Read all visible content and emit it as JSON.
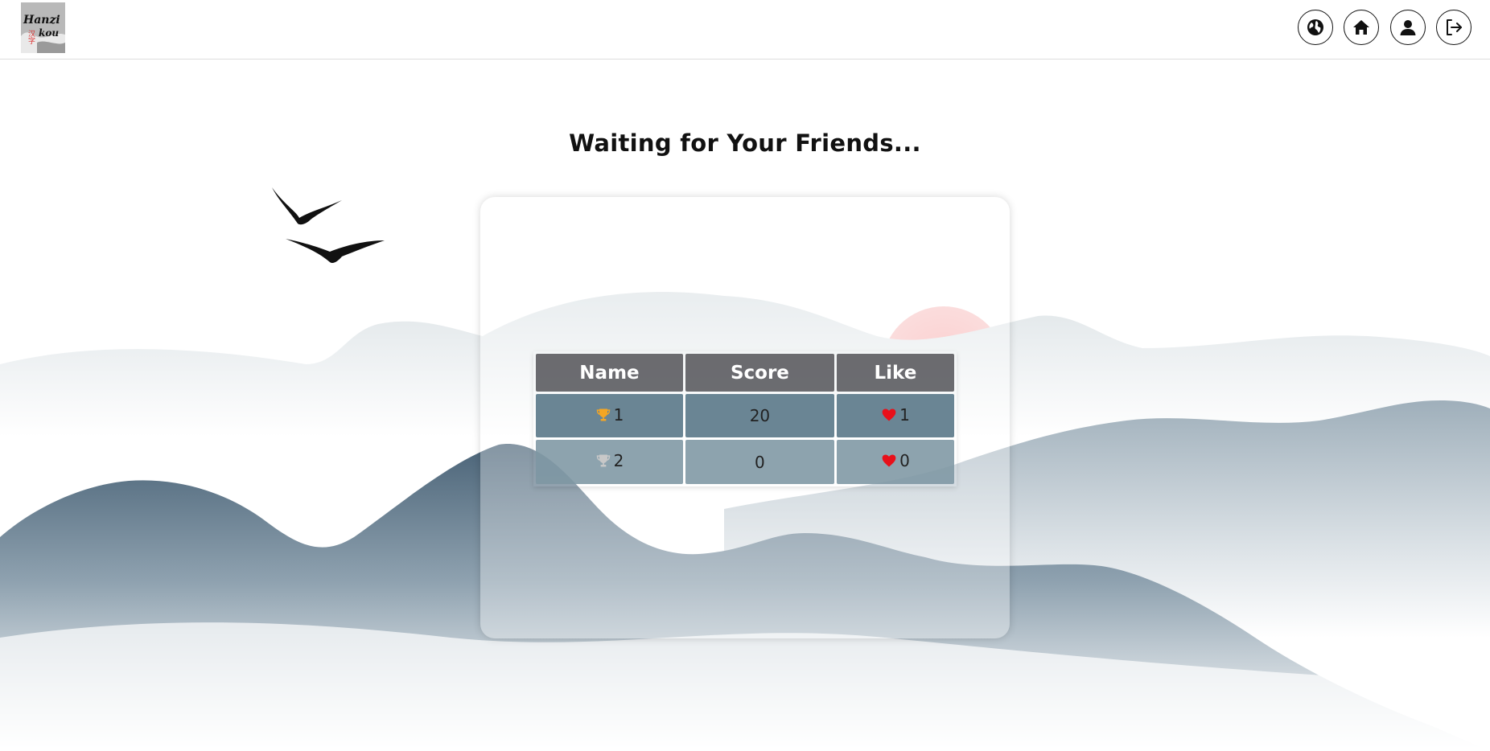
{
  "header": {
    "logo_alt": "Hanzi kou",
    "nav": [
      {
        "icon": "globe-icon",
        "label": "Language"
      },
      {
        "icon": "home-icon",
        "label": "Home"
      },
      {
        "icon": "user-icon",
        "label": "Profile"
      },
      {
        "icon": "logout-icon",
        "label": "Log out"
      }
    ]
  },
  "main": {
    "title": "Waiting for Your Friends..."
  },
  "scoreboard": {
    "columns": [
      "Name",
      "Score",
      "Like"
    ],
    "rows": [
      {
        "rank_icon": "gold-trophy-icon",
        "name": "1",
        "score": "20",
        "like_icon": "heart-icon",
        "likes": "1"
      },
      {
        "rank_icon": "silver-trophy-icon",
        "name": "2",
        "score": "0",
        "like_icon": "heart-icon",
        "likes": "0"
      }
    ]
  },
  "colors": {
    "header_cell": "#58585c",
    "row_first": "#5a7888",
    "row_second": "#7d96a3",
    "gold_trophy": "#f5a623",
    "silver_trophy": "#c8c8c8",
    "heart": "#e8101a",
    "sun": "#f7b3b3",
    "mountain_dark": "#4a6377",
    "mountain_light": "#aebcc6"
  }
}
